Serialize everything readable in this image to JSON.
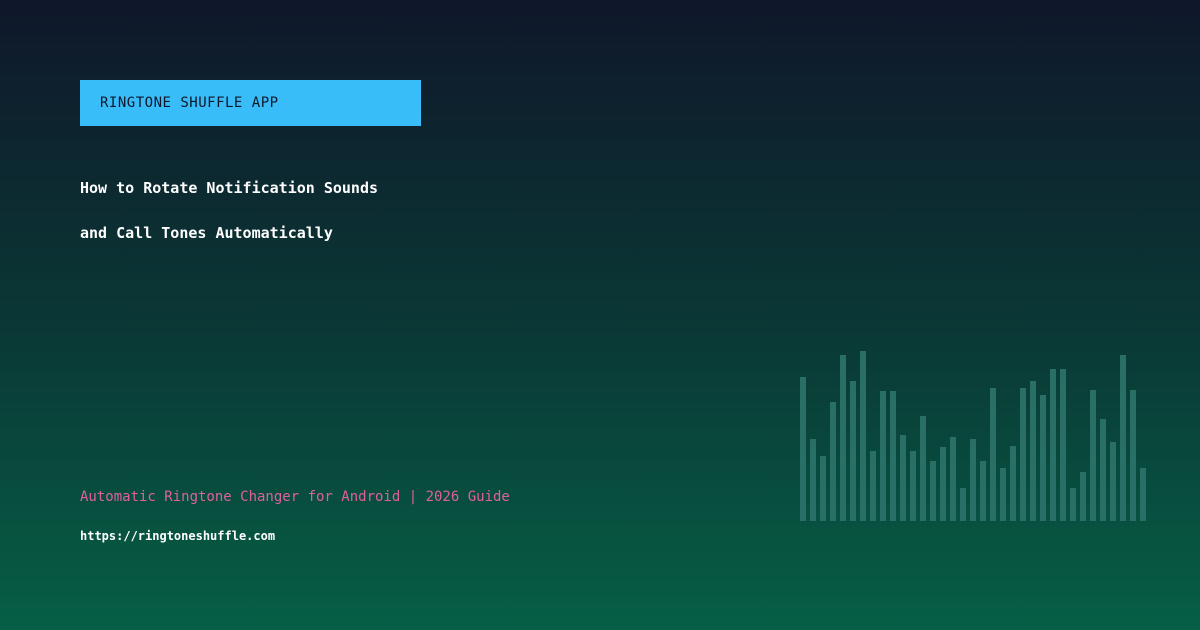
{
  "badge": {
    "label": "RINGTONE SHUFFLE APP",
    "bg_color": "#38bdf8"
  },
  "headline": {
    "line1": "How to Rotate Notification Sounds",
    "line2": "and Call Tones Automatically"
  },
  "tagline": "Automatic Ringtone Changer for Android | 2026 Guide",
  "url": "https://ringtoneshuffle.com",
  "equalizer": {
    "levels": [
      0.82,
      0.47,
      0.37,
      0.68,
      0.95,
      0.8,
      0.97,
      0.4,
      0.74,
      0.74,
      0.49,
      0.4,
      0.6,
      0.34,
      0.42,
      0.48,
      0.19,
      0.47,
      0.34,
      0.76,
      0.3,
      0.43,
      0.76,
      0.8,
      0.72,
      0.87,
      0.87,
      0.19,
      0.28,
      0.75,
      0.58,
      0.45,
      0.95,
      0.75,
      0.3
    ],
    "bar_color": "#2a6f66"
  }
}
